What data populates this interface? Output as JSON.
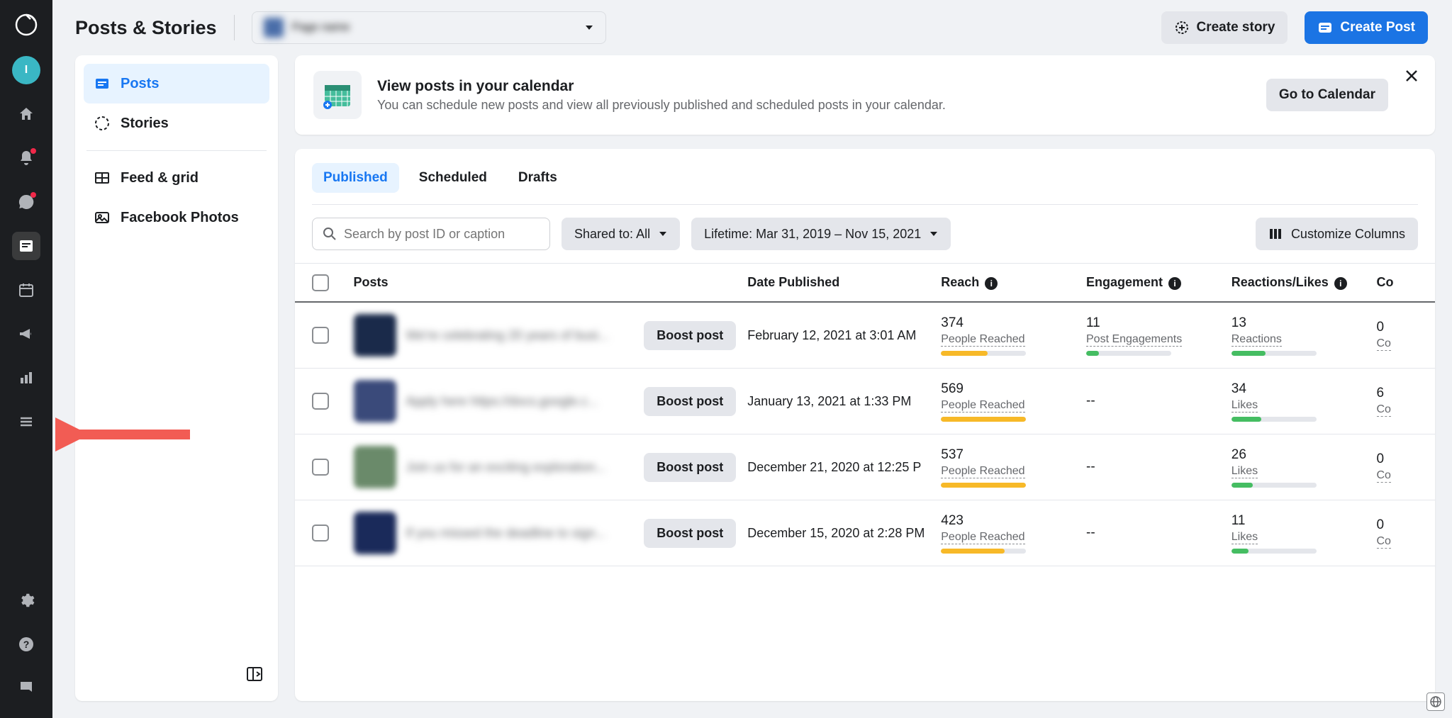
{
  "rail": {
    "avatar_letter": "I"
  },
  "header": {
    "title": "Posts & Stories",
    "picker_placeholder": "Page name",
    "create_story": "Create story",
    "create_post": "Create Post"
  },
  "sidebar": {
    "items": [
      {
        "label": "Posts"
      },
      {
        "label": "Stories"
      },
      {
        "label": "Feed & grid"
      },
      {
        "label": "Facebook Photos"
      }
    ]
  },
  "banner": {
    "title": "View posts in your calendar",
    "subtitle": "You can schedule new posts and view all previously published and scheduled posts in your calendar.",
    "button": "Go to Calendar"
  },
  "tabs": [
    {
      "label": "Published"
    },
    {
      "label": "Scheduled"
    },
    {
      "label": "Drafts"
    }
  ],
  "filters": {
    "search_placeholder": "Search by post ID or caption",
    "shared_to": "Shared to: All",
    "daterange": "Lifetime: Mar 31, 2019 – Nov 15, 2021",
    "customize": "Customize Columns"
  },
  "columns": {
    "posts": "Posts",
    "date": "Date Published",
    "reach": "Reach",
    "engagement": "Engagement",
    "reactions": "Reactions/Likes",
    "comments": "Co"
  },
  "boost_label": "Boost post",
  "metric_labels": {
    "people_reached": "People Reached",
    "post_engagements": "Post Engagements",
    "reactions": "Reactions",
    "likes": "Likes",
    "comments": "Co"
  },
  "rows": [
    {
      "title": "We're celebrating 20 years of busi...",
      "date": "February 12, 2021 at 3:01 AM",
      "reach": "374",
      "reach_pct": 55,
      "eng": "11",
      "eng_pct": 15,
      "eng_label": "Post Engagements",
      "react": "13",
      "react_pct": 40,
      "react_label": "Reactions",
      "com": "0",
      "com_label": "Co",
      "thumb_color": "#1a2a4a"
    },
    {
      "title": "Apply here https://docs.google.c...",
      "date": "January 13, 2021 at 1:33 PM",
      "reach": "569",
      "reach_pct": 100,
      "eng": "--",
      "eng_pct": 0,
      "eng_label": "",
      "react": "34",
      "react_pct": 35,
      "react_label": "Likes",
      "com": "6",
      "com_label": "Co",
      "thumb_color": "#3a4a7a"
    },
    {
      "title": "Join us for an exciting exploration...",
      "date": "December 21, 2020 at 12:25 P",
      "reach": "537",
      "reach_pct": 100,
      "eng": "--",
      "eng_pct": 0,
      "eng_label": "",
      "react": "26",
      "react_pct": 25,
      "react_label": "Likes",
      "com": "0",
      "com_label": "Co",
      "thumb_color": "#6a8a6a"
    },
    {
      "title": "If you missed the deadline to sign...",
      "date": "December 15, 2020 at 2:28 PM",
      "reach": "423",
      "reach_pct": 75,
      "eng": "--",
      "eng_pct": 0,
      "eng_label": "",
      "react": "11",
      "react_pct": 20,
      "react_label": "Likes",
      "com": "0",
      "com_label": "Co",
      "thumb_color": "#1a2a5a"
    }
  ]
}
